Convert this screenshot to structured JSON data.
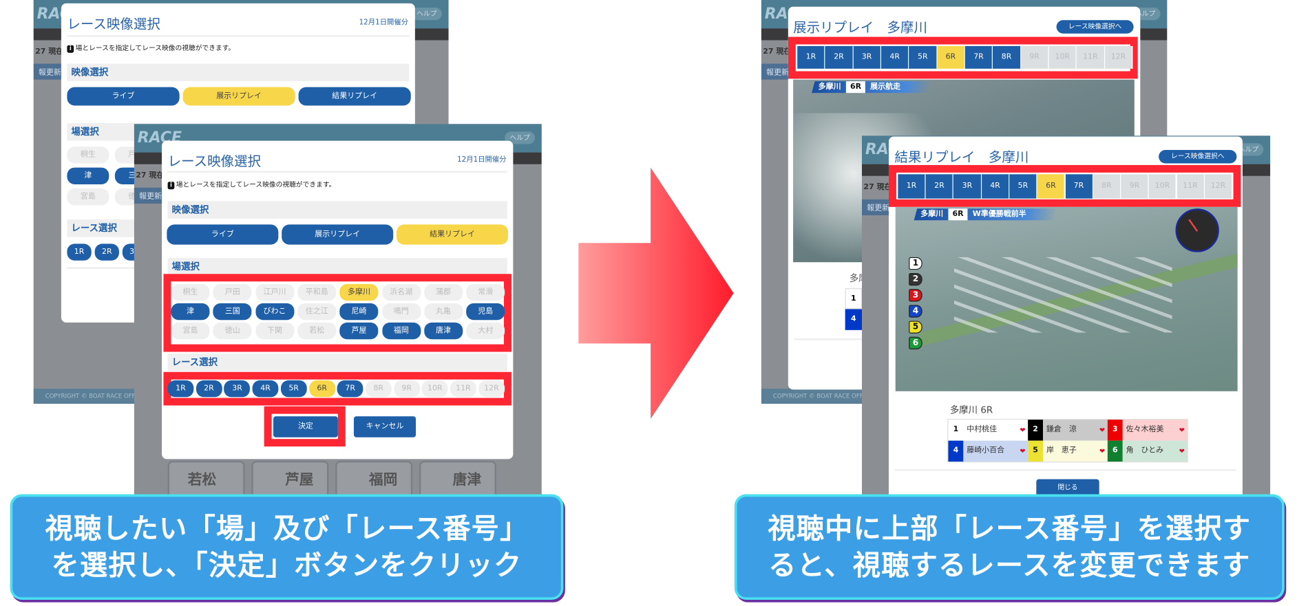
{
  "colors": {
    "blue": "#1f5fa8",
    "yellow": "#f7d64a",
    "gray": "#efefef",
    "highlight_red": "#ff2634",
    "caption_blue": "#3c9fe6",
    "arrow_red": "#ff2634"
  },
  "background_page": {
    "logo": "RACE",
    "help": "ヘルプ",
    "time": "27 現在",
    "update": "報更新",
    "copyright": "COPYRIGHT © BOAT RACE OFFICIAL",
    "cards": [
      "若松",
      "芦屋",
      "福岡",
      "唐津"
    ]
  },
  "step1": {
    "back_modal": {
      "title": "レース映像選択",
      "date": "12月1日開催分",
      "info": "場とレースを指定してレース映像の視聴ができます。",
      "section_video": "映像選択",
      "video_buttons": [
        {
          "label": "ライブ",
          "state": "blue"
        },
        {
          "label": "展示リプレイ",
          "state": "yellow"
        },
        {
          "label": "結果リプレイ",
          "state": "blue"
        }
      ],
      "section_venue": "場選択",
      "venues": [
        {
          "label": "桐生",
          "state": "gray"
        },
        {
          "label": "戸田",
          "state": "gray"
        },
        {
          "label": "津",
          "state": "blue"
        },
        {
          "label": "三国",
          "state": "blue"
        },
        {
          "label": "宮島",
          "state": "gray"
        },
        {
          "label": "徳山",
          "state": "gray"
        }
      ],
      "section_race": "レース選択",
      "races": [
        {
          "label": "1R",
          "state": "blue"
        },
        {
          "label": "2R",
          "state": "blue"
        },
        {
          "label": "3R",
          "state": "blue"
        }
      ]
    },
    "front_modal": {
      "title": "レース映像選択",
      "date": "12月1日開催分",
      "info": "場とレースを指定してレース映像の視聴ができます。",
      "section_video": "映像選択",
      "video_buttons": [
        {
          "label": "ライブ",
          "state": "blue"
        },
        {
          "label": "展示リプレイ",
          "state": "blue"
        },
        {
          "label": "結果リプレイ",
          "state": "yellow"
        }
      ],
      "section_venue": "場選択",
      "venues": [
        {
          "label": "桐生",
          "state": "gray"
        },
        {
          "label": "戸田",
          "state": "gray"
        },
        {
          "label": "江戸川",
          "state": "gray"
        },
        {
          "label": "平和島",
          "state": "gray"
        },
        {
          "label": "多摩川",
          "state": "yellow"
        },
        {
          "label": "浜名湖",
          "state": "gray"
        },
        {
          "label": "蒲郡",
          "state": "gray"
        },
        {
          "label": "常滑",
          "state": "gray"
        },
        {
          "label": "津",
          "state": "blue"
        },
        {
          "label": "三国",
          "state": "blue"
        },
        {
          "label": "びわこ",
          "state": "blue"
        },
        {
          "label": "住之江",
          "state": "gray"
        },
        {
          "label": "尼崎",
          "state": "blue"
        },
        {
          "label": "鳴門",
          "state": "gray"
        },
        {
          "label": "丸亀",
          "state": "gray"
        },
        {
          "label": "児島",
          "state": "blue"
        },
        {
          "label": "宮島",
          "state": "gray"
        },
        {
          "label": "徳山",
          "state": "gray"
        },
        {
          "label": "下関",
          "state": "gray"
        },
        {
          "label": "若松",
          "state": "gray"
        },
        {
          "label": "芦屋",
          "state": "blue"
        },
        {
          "label": "福岡",
          "state": "blue"
        },
        {
          "label": "唐津",
          "state": "blue"
        },
        {
          "label": "大村",
          "state": "gray"
        }
      ],
      "section_race": "レース選択",
      "races": [
        {
          "label": "1R",
          "state": "blue"
        },
        {
          "label": "2R",
          "state": "blue"
        },
        {
          "label": "3R",
          "state": "blue"
        },
        {
          "label": "4R",
          "state": "blue"
        },
        {
          "label": "5R",
          "state": "blue"
        },
        {
          "label": "6R",
          "state": "yellow"
        },
        {
          "label": "7R",
          "state": "blue"
        },
        {
          "label": "8R",
          "state": "gray"
        },
        {
          "label": "9R",
          "state": "gray"
        },
        {
          "label": "10R",
          "state": "gray"
        },
        {
          "label": "11R",
          "state": "gray"
        },
        {
          "label": "12R",
          "state": "gray"
        }
      ],
      "confirm": "決定",
      "cancel": "キャンセル"
    },
    "caption": [
      "視聴したい「場」及び「レース番号」",
      "を選択し、「決定」ボタンをクリック"
    ]
  },
  "step2": {
    "exhibition": {
      "title": "展示リプレイ　多摩川",
      "back_button": "レース映像選択へ",
      "tabs": [
        {
          "label": "1R",
          "state": "blue"
        },
        {
          "label": "2R",
          "state": "blue"
        },
        {
          "label": "3R",
          "state": "blue"
        },
        {
          "label": "4R",
          "state": "blue"
        },
        {
          "label": "5R",
          "state": "blue"
        },
        {
          "label": "6R",
          "state": "yellow"
        },
        {
          "label": "7R",
          "state": "blue"
        },
        {
          "label": "8R",
          "state": "blue"
        },
        {
          "label": "9R",
          "state": "gray"
        },
        {
          "label": "10R",
          "state": "gray"
        },
        {
          "label": "11R",
          "state": "gray"
        },
        {
          "label": "12R",
          "state": "gray"
        }
      ],
      "video_overlay": {
        "venue": "多摩川",
        "race": "6R",
        "label": "展示航走"
      },
      "below_title": "多摩川",
      "below_cells": [
        "1",
        "4"
      ]
    },
    "result": {
      "title": "結果リプレイ　多摩川",
      "back_button": "レース映像選択へ",
      "tabs": [
        {
          "label": "1R",
          "state": "blue"
        },
        {
          "label": "2R",
          "state": "blue"
        },
        {
          "label": "3R",
          "state": "blue"
        },
        {
          "label": "4R",
          "state": "blue"
        },
        {
          "label": "5R",
          "state": "blue"
        },
        {
          "label": "6R",
          "state": "yellow"
        },
        {
          "label": "7R",
          "state": "blue"
        },
        {
          "label": "8R",
          "state": "gray"
        },
        {
          "label": "9R",
          "state": "gray"
        },
        {
          "label": "10R",
          "state": "gray"
        },
        {
          "label": "11R",
          "state": "gray"
        },
        {
          "label": "12R",
          "state": "gray"
        }
      ],
      "video_overlay": {
        "venue": "多摩川",
        "race": "6R",
        "label": "W準優勝戦前半"
      },
      "boat_markers": [
        {
          "n": "1",
          "color": "#ffffff",
          "text": "#111111"
        },
        {
          "n": "2",
          "color": "#333333",
          "text": "#ffffff"
        },
        {
          "n": "3",
          "color": "#d8161e",
          "text": "#ffffff"
        },
        {
          "n": "4",
          "color": "#1346c8",
          "text": "#ffffff"
        },
        {
          "n": "5",
          "color": "#f0e224",
          "text": "#111111"
        },
        {
          "n": "6",
          "color": "#1f9a3a",
          "text": "#ffffff"
        }
      ],
      "race_label": "多摩川 6R",
      "racers": [
        {
          "n": "1",
          "name": "中村桃佳",
          "num_bg": "#ffffff",
          "num_fg": "#111111",
          "name_bg": "#ffffff"
        },
        {
          "n": "2",
          "name": "鎌倉　涼",
          "num_bg": "#000000",
          "num_fg": "#ffffff",
          "name_bg": "#c9c9c9"
        },
        {
          "n": "3",
          "name": "佐々木裕美",
          "num_bg": "#ee0000",
          "num_fg": "#ffffff",
          "name_bg": "#fcd0d0"
        },
        {
          "n": "4",
          "name": "藤崎小百合",
          "num_bg": "#0038c8",
          "num_fg": "#ffffff",
          "name_bg": "#c9d6f2"
        },
        {
          "n": "5",
          "name": "岸　恵子",
          "num_bg": "#ece234",
          "num_fg": "#111111",
          "name_bg": "#fbfadd"
        },
        {
          "n": "6",
          "name": "角　ひとみ",
          "num_bg": "#108030",
          "num_fg": "#ffffff",
          "name_bg": "#cde6d8"
        }
      ],
      "close": "閉じる"
    },
    "caption": [
      "視聴中に上部「レース番号」を選択す",
      "ると、視聴するレースを変更できます"
    ]
  }
}
